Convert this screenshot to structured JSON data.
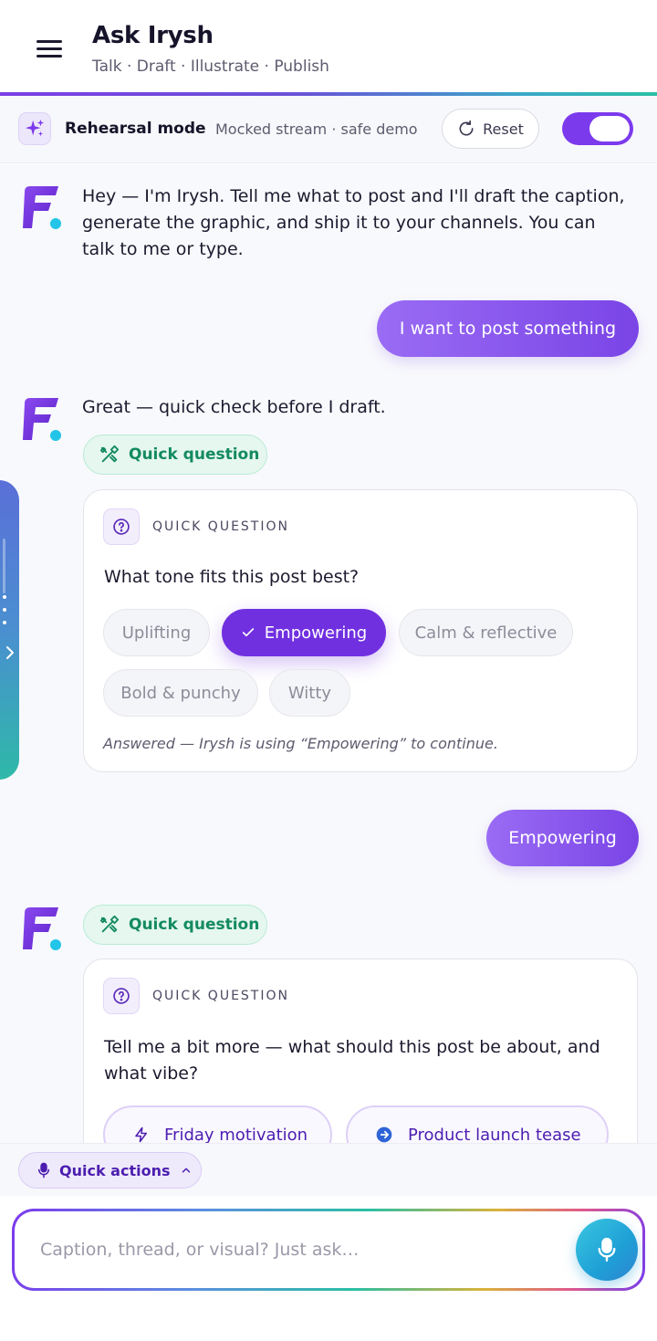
{
  "header": {
    "title": "Ask Irysh",
    "subtitle": "Talk · Draft · Illustrate · Publish"
  },
  "rehearsal": {
    "title": "Rehearsal mode",
    "note": "Mocked stream · safe demo",
    "reset_label": "Reset",
    "toggle_on": true
  },
  "messages": {
    "bot_intro": "Hey — I'm Irysh. Tell me what to post and I'll draft the caption, generate the graphic, and ship it to your channels. You can talk to me or type.",
    "user_1": "I want to post something",
    "bot_2": "Great — quick check before I draft.",
    "user_2": "Empowering"
  },
  "tool_chip": {
    "label": "Quick question"
  },
  "question_1": {
    "header": "QUICK QUESTION",
    "text": "What tone fits this post best?",
    "options": [
      "Uplifting",
      "Empowering",
      "Calm & reflective",
      "Bold & punchy",
      "Witty"
    ],
    "selected": "Empowering",
    "answered_note": "Answered — Irysh is using “Empowering” to continue."
  },
  "question_2": {
    "header": "QUICK QUESTION",
    "text": "Tell me a bit more — what should this post be about, and what vibe?",
    "suggestions": [
      "Friday motivation",
      "Product launch tease"
    ]
  },
  "quick_actions": {
    "label": "Quick actions"
  },
  "composer": {
    "placeholder": "Caption, thread, or visual? Just ask…"
  },
  "colors": {
    "accent": "#7c3aed",
    "success": "#138a60",
    "mic": "#1e9fd6"
  }
}
